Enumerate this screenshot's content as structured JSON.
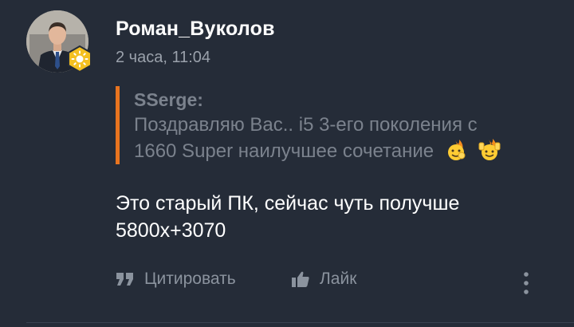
{
  "post": {
    "author": "Роман_Вуколов",
    "timestamp": "2 часа, 11:04",
    "avatar_icon": "user-photo",
    "badge_icon": "sun-badge",
    "quote": {
      "author": "SSerge:",
      "line1": "Поздравляю Вас.. i5 3-его поколения с",
      "line2": "1660 Super наилучшее сочетание",
      "emojis": [
        "ok-hand-emoji",
        "raised-hands-emoji"
      ]
    },
    "message": {
      "line1": "Это старый ПК, сейчас чуть получше",
      "line2": "5800x+3070"
    }
  },
  "actions": {
    "quote_label": "Цитировать",
    "like_label": "Лайк",
    "more_icon": "vertical-dots-icon"
  },
  "colors": {
    "background": "#252c38",
    "accent_quote_bar": "#e8741f",
    "muted_text": "#7b828d",
    "action_text": "#8b939e",
    "badge": "#f4c020"
  }
}
